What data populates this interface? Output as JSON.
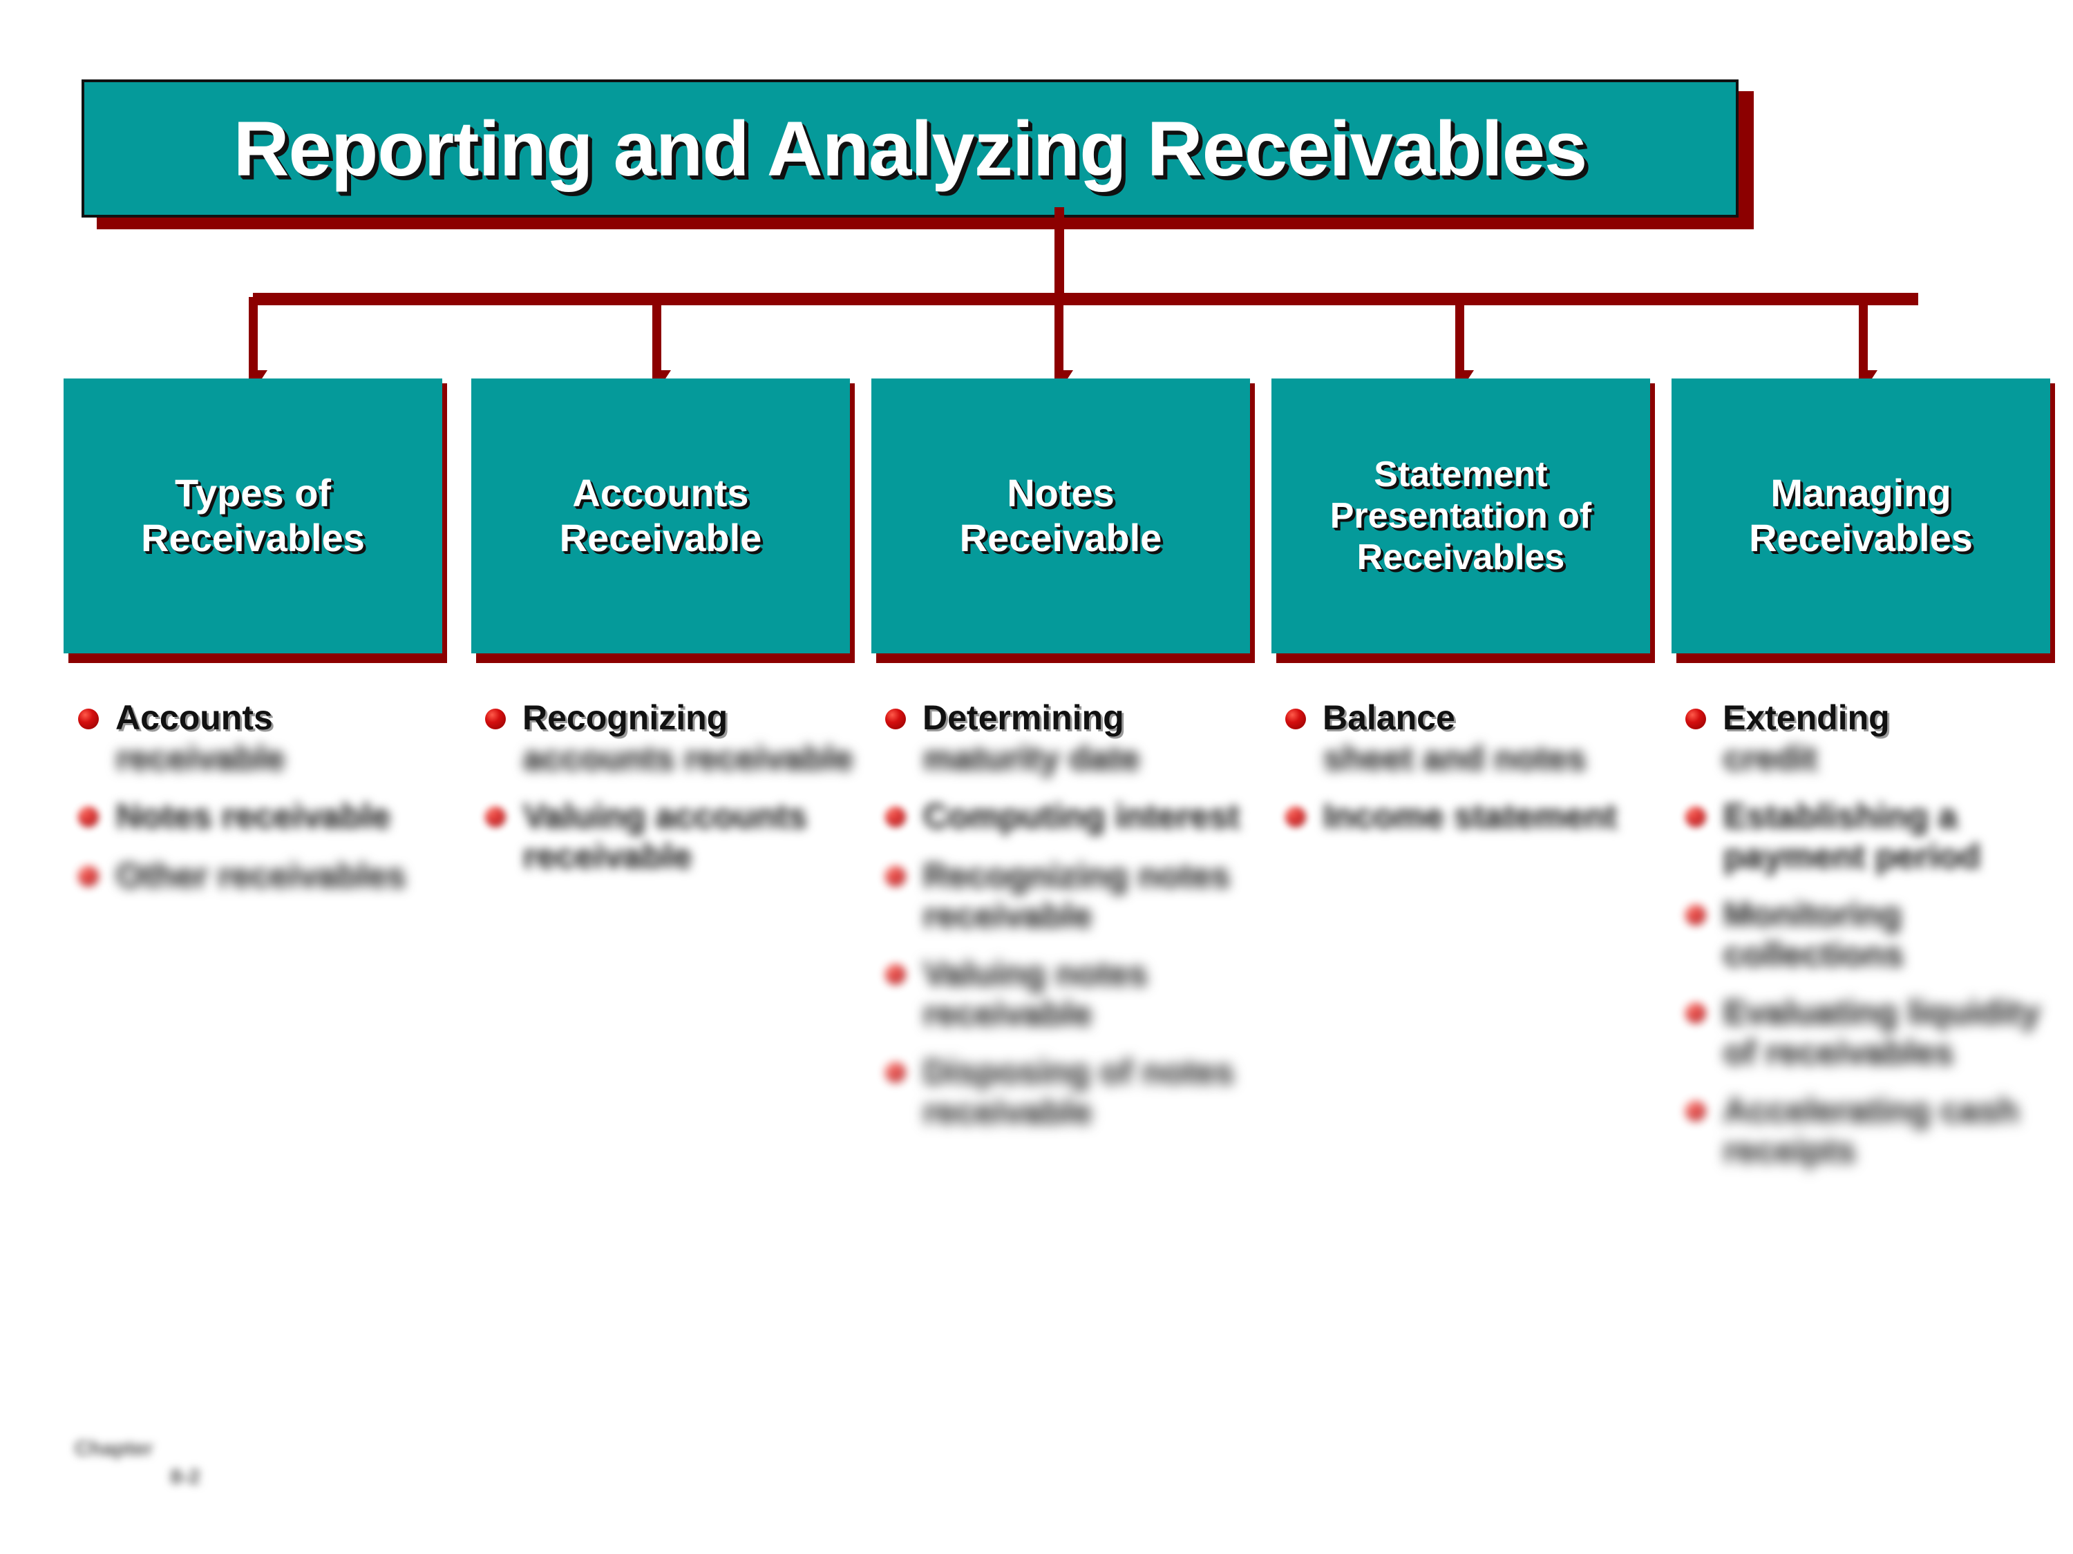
{
  "slide": {
    "title": "Reporting and Analyzing Receivables",
    "accent_teal": "#059A9A",
    "accent_dark_red": "#8C0000",
    "bullet_dot_color": "#D40F0F",
    "title_text_color": "#FFFFFF",
    "background": "#FFFFFF"
  },
  "categories": [
    {
      "label_line1": "Types of",
      "label_line2": "Receivables",
      "label_line3": ""
    },
    {
      "label_line1": "Accounts",
      "label_line2": "Receivable",
      "label_line3": ""
    },
    {
      "label_line1": "Notes",
      "label_line2": "Receivable",
      "label_line3": ""
    },
    {
      "label_line1": "Statement",
      "label_line2": "Presentation of",
      "label_line3": "Receivables"
    },
    {
      "label_line1": "Managing",
      "label_line2": "Receivables",
      "label_line3": ""
    }
  ],
  "columns": [
    {
      "items": [
        {
          "line1": "Accounts",
          "line2": "receivable"
        },
        {
          "text": "Notes receivable"
        },
        {
          "text": "Other receivables"
        }
      ]
    },
    {
      "items": [
        {
          "line1": "Recognizing",
          "line2": "accounts receivable"
        },
        {
          "text": "Valuing accounts receivable"
        }
      ]
    },
    {
      "items": [
        {
          "line1": "Determining",
          "line2": "maturity date"
        },
        {
          "text": "Computing interest"
        },
        {
          "text": "Recognizing notes receivable"
        },
        {
          "text": "Valuing notes receivable"
        },
        {
          "text": "Disposing of notes receivable"
        }
      ]
    },
    {
      "items": [
        {
          "line1": "Balance",
          "line2": "sheet and notes"
        },
        {
          "text": "Income statement"
        }
      ]
    },
    {
      "items": [
        {
          "line1": "Extending",
          "line2": "credit"
        },
        {
          "text": "Establishing a payment period"
        },
        {
          "text": "Monitoring collections"
        },
        {
          "text": "Evaluating liquidity of receivables"
        },
        {
          "text": "Accelerating cash receipts"
        }
      ]
    }
  ],
  "footer": {
    "line1": "Chapter",
    "line2": "8-2"
  }
}
